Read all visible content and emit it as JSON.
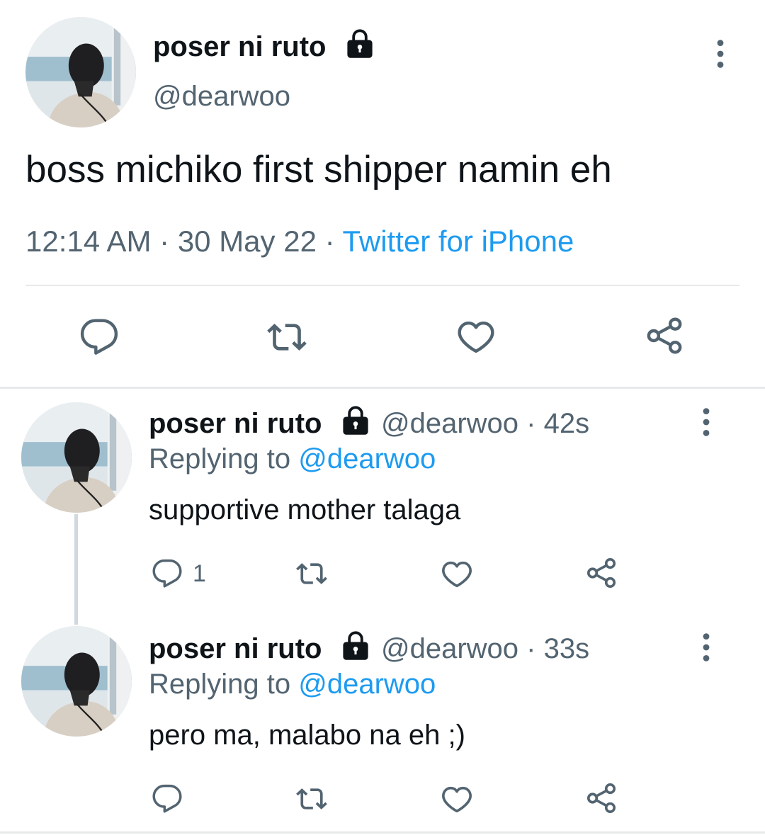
{
  "main_tweet": {
    "display_name": "poser ni ruto",
    "handle": "@dearwoo",
    "text": "boss michiko first shipper namin eh",
    "time": "12:14 AM",
    "sep1": "·",
    "date": "30 May 22",
    "sep2": "·",
    "source": "Twitter for iPhone"
  },
  "replies": [
    {
      "display_name": "poser ni ruto",
      "handle": "@dearwoo",
      "dot": "·",
      "age": "42s",
      "replying_prefix": "Replying to",
      "replying_handle": "@dearwoo",
      "text": "supportive mother talaga",
      "reply_count": "1"
    },
    {
      "display_name": "poser ni ruto",
      "handle": "@dearwoo",
      "dot": "·",
      "age": "33s",
      "replying_prefix": "Replying to",
      "replying_handle": "@dearwoo",
      "text": "pero ma, malabo na eh ;)",
      "reply_count": ""
    }
  ],
  "icons": {
    "reply": "speech-bubble-icon",
    "retweet": "retweet-icon",
    "like": "heart-icon",
    "share": "share-icon",
    "more": "more-vertical-icon",
    "lock": "lock-icon"
  },
  "colors": {
    "text": "#0f1419",
    "secondary": "#536471",
    "link": "#1d9bf0",
    "divider": "#e7e9ea"
  }
}
